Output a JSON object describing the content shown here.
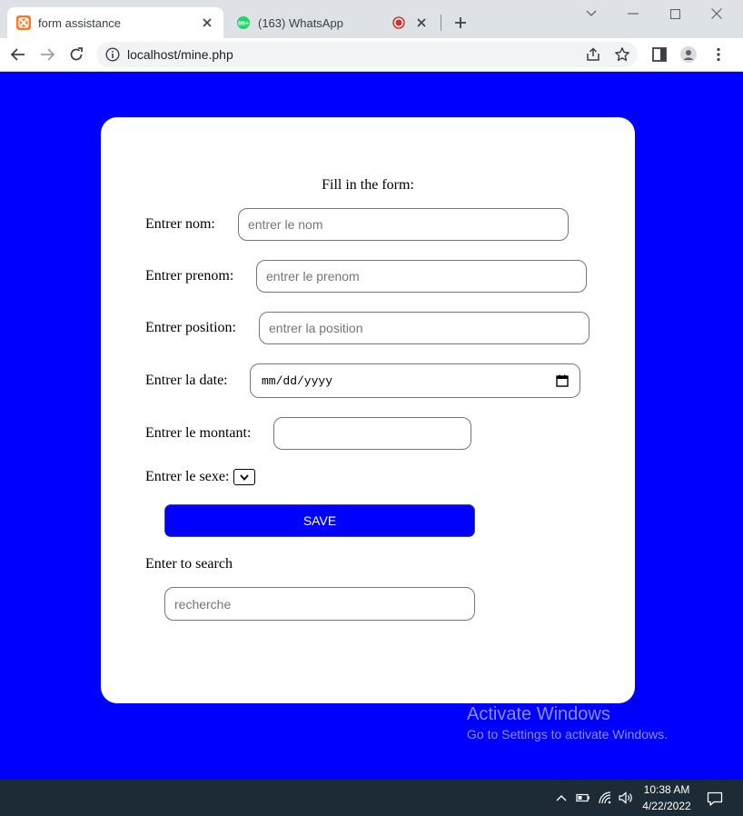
{
  "browser": {
    "tabs": [
      {
        "title": "form assistance",
        "active": true,
        "icon": "xampp-icon"
      },
      {
        "title": "(163) WhatsApp",
        "active": false,
        "icon": "whatsapp-icon",
        "badge": "99+"
      }
    ],
    "address": {
      "host": "localhost",
      "path": "/mine.php"
    }
  },
  "form": {
    "heading": "Fill in the form:",
    "fields": {
      "nom": {
        "label": "Entrer nom:",
        "placeholder": "entrer le nom"
      },
      "prenom": {
        "label": "Entrer prenom:",
        "placeholder": "entrer le prenom"
      },
      "position": {
        "label": "Entrer position:",
        "placeholder": "entrer la position"
      },
      "date": {
        "label": "Entrer la date:",
        "placeholder": "mm/dd/yyyy"
      },
      "montant": {
        "label": "Entrer le montant:",
        "placeholder": ""
      },
      "sexe": {
        "label": "Entrer le sexe:"
      }
    },
    "save_label": "SAVE",
    "search": {
      "label": "Enter to search",
      "placeholder": "recherche"
    }
  },
  "watermark": {
    "title": "Activate Windows",
    "subtitle": "Go to Settings to activate Windows."
  },
  "taskbar": {
    "time": "10:38 AM",
    "date": "4/22/2022"
  },
  "colors": {
    "page_background": "#0000ff",
    "button": "#0000ff",
    "card": "#ffffff"
  }
}
